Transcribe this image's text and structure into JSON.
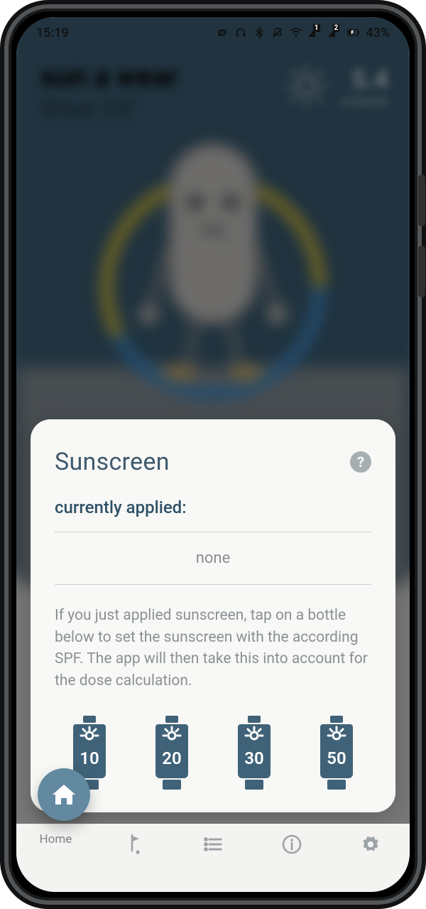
{
  "status": {
    "time": "15:19",
    "battery": "43%"
  },
  "background": {
    "title_line1": "sun a wear",
    "title_line2": "Wear UV",
    "uv_value": "5.4",
    "uv_caption": "moderate"
  },
  "sheet": {
    "title": "Sunscreen",
    "applied_label": "currently applied:",
    "applied_value": "none",
    "instructions": "If you just applied sunscreen, tap on a bottle below to set the sunscreen with the according SPF. The app will then take this into account for the dose calculation.",
    "spf_options": [
      {
        "label": "10"
      },
      {
        "label": "20"
      },
      {
        "label": "30"
      },
      {
        "label": "50"
      }
    ]
  },
  "nav": {
    "items": [
      {
        "label": "Home",
        "icon": "home"
      },
      {
        "label": "",
        "icon": "flag"
      },
      {
        "label": "",
        "icon": "list"
      },
      {
        "label": "",
        "icon": "info"
      },
      {
        "label": "",
        "icon": "gear"
      }
    ]
  },
  "colors": {
    "brand": "#3c5c72",
    "bottle": "#3f6278",
    "fab": "#6289a0"
  }
}
